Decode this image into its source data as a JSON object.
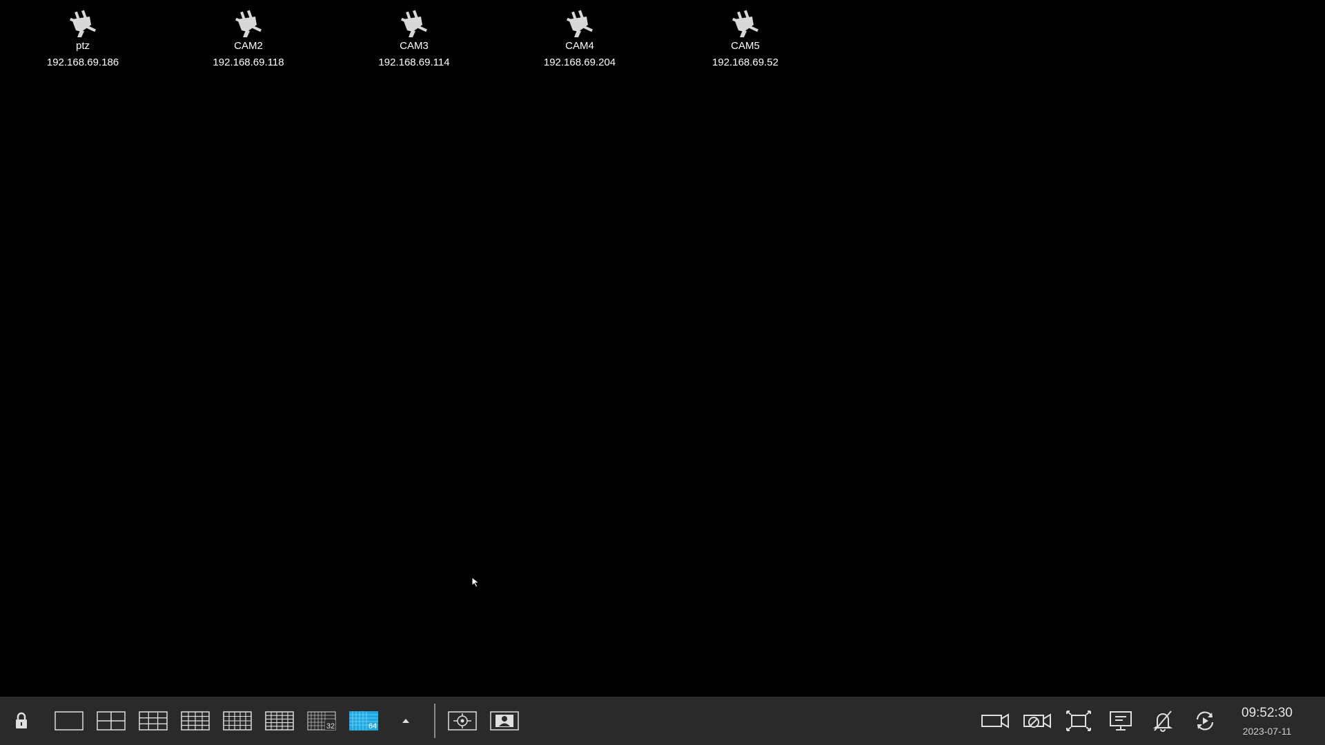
{
  "cameras": [
    {
      "name": "ptz",
      "ip": "192.168.69.186",
      "icon": "disconnected-plug-icon"
    },
    {
      "name": "CAM2",
      "ip": "192.168.69.118",
      "icon": "disconnected-plug-icon"
    },
    {
      "name": "CAM3",
      "ip": "192.168.69.114",
      "icon": "disconnected-plug-icon"
    },
    {
      "name": "CAM4",
      "ip": "192.168.69.204",
      "icon": "disconnected-plug-icon"
    },
    {
      "name": "CAM5",
      "ip": "192.168.69.52",
      "icon": "disconnected-plug-icon"
    }
  ],
  "taskbar": {
    "layouts": [
      {
        "icon": "layout-1-icon"
      },
      {
        "icon": "layout-4-icon"
      },
      {
        "icon": "layout-9-icon"
      },
      {
        "icon": "layout-16-icon"
      },
      {
        "icon": "layout-20-icon"
      },
      {
        "icon": "layout-25-icon"
      },
      {
        "icon": "layout-32-icon",
        "label": "32"
      },
      {
        "icon": "layout-64-icon",
        "label": "64",
        "selected": true
      }
    ],
    "clock": {
      "time": "09:52:30",
      "date": "2023-07-11"
    },
    "colors": {
      "background": "#2a2a2a",
      "selected": "#1fa8e0",
      "icon": "#e0e0e0"
    }
  }
}
